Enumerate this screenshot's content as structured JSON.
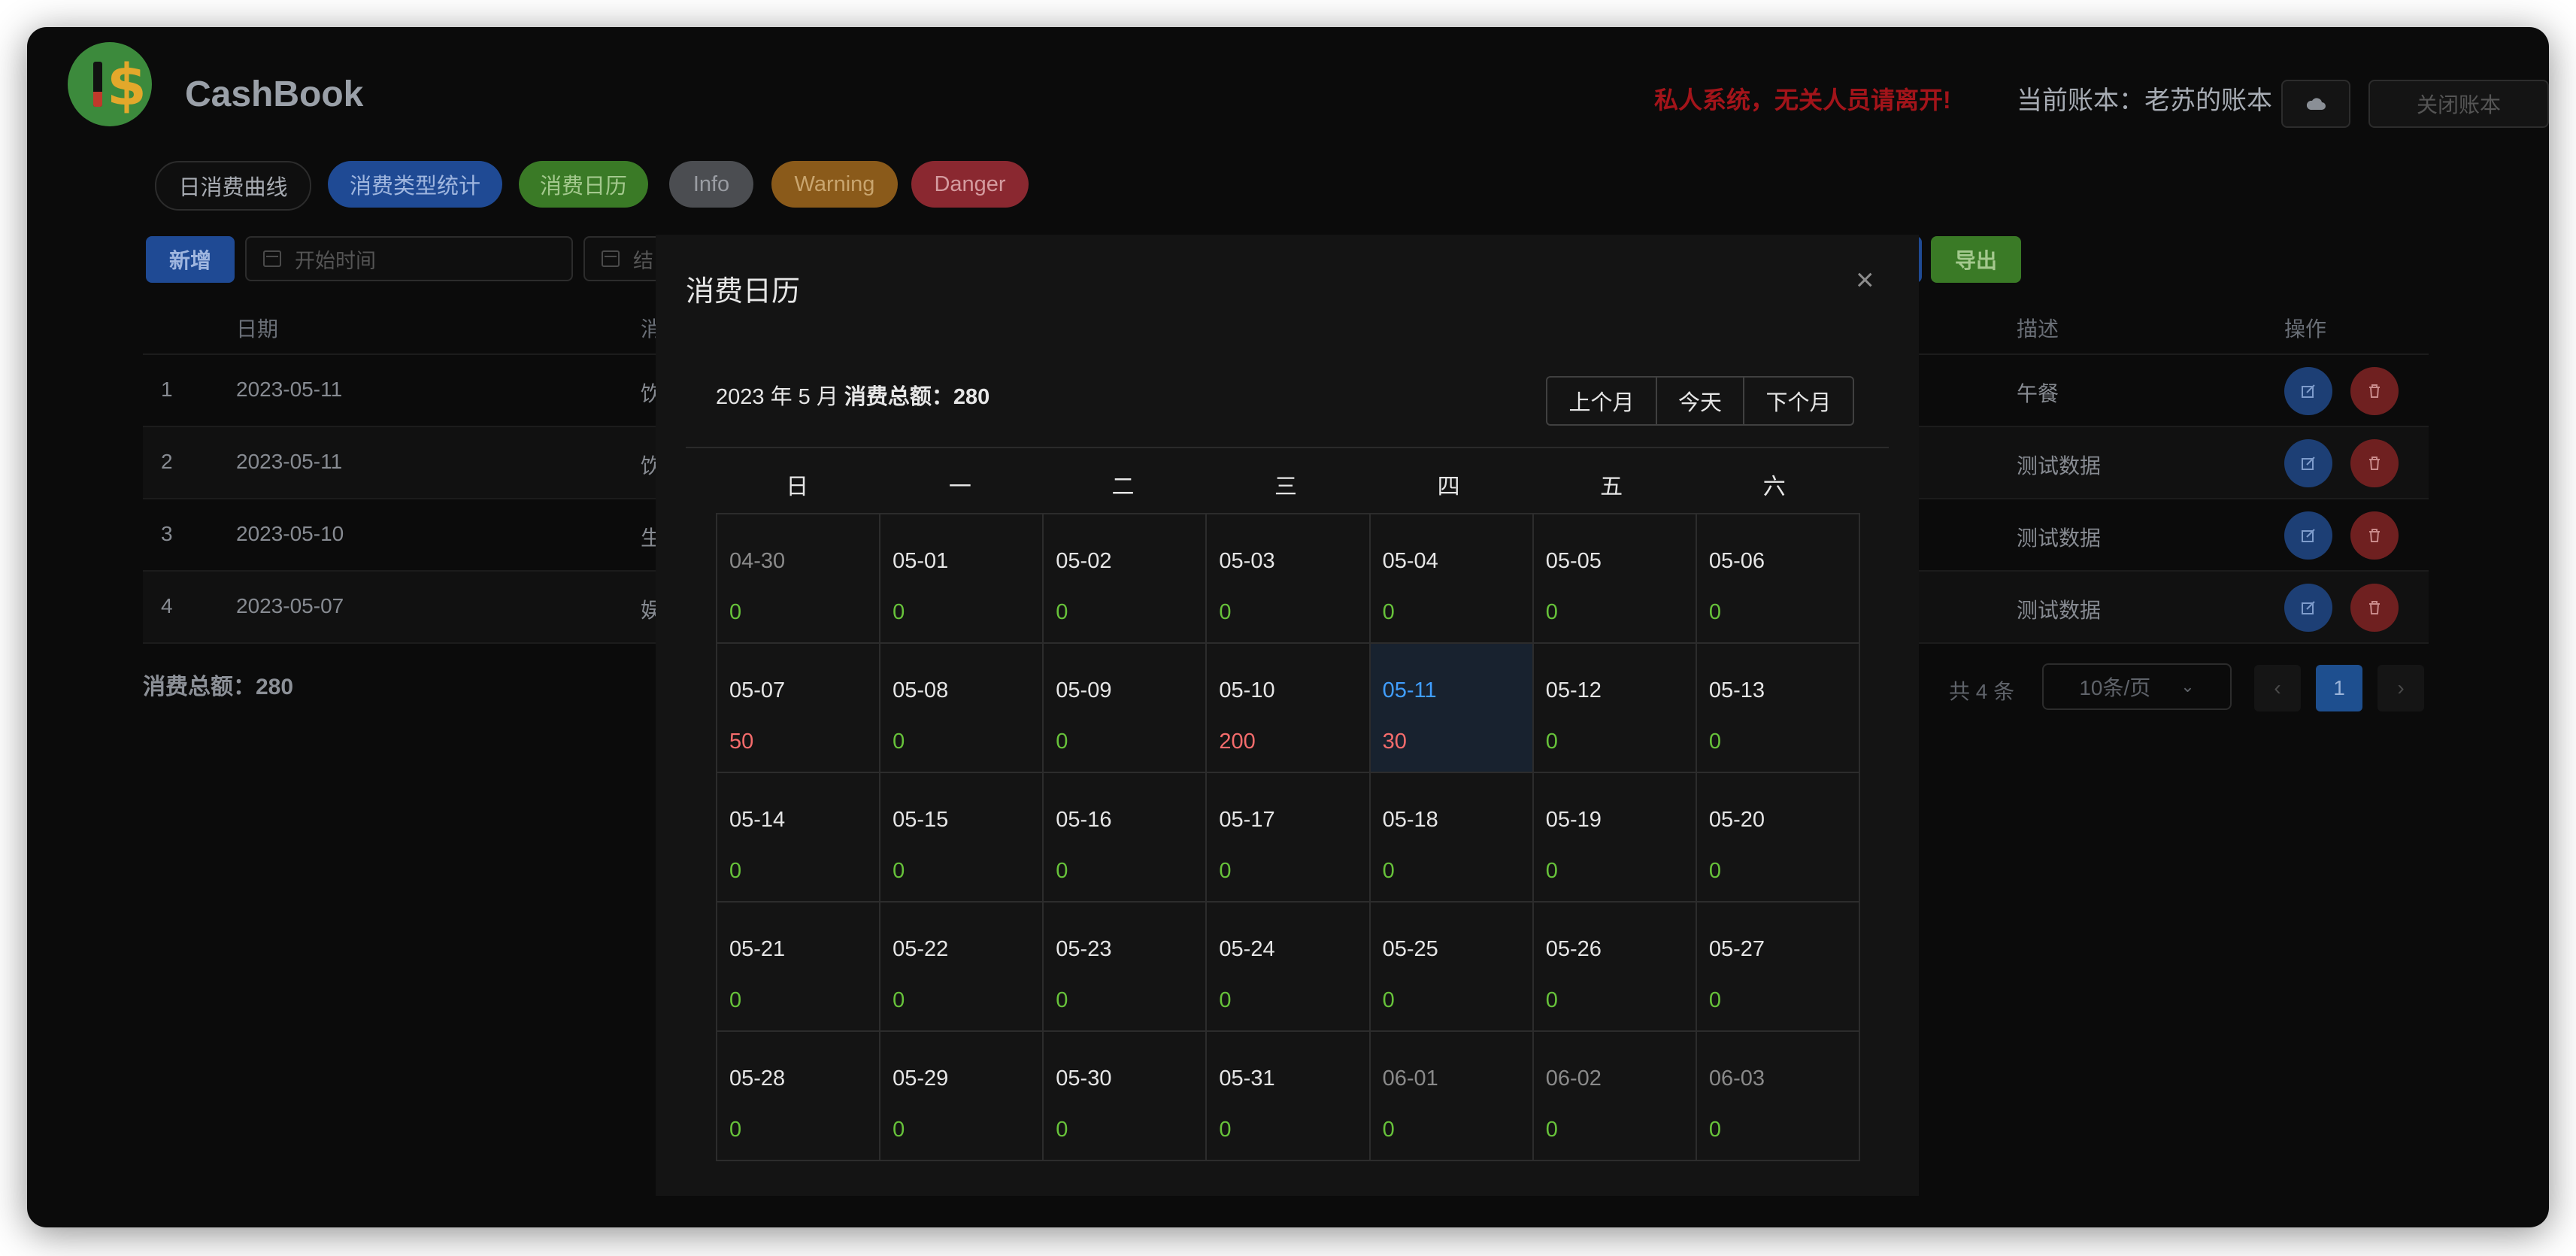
{
  "app": {
    "title": "CashBook",
    "warning": "私人系统，无关人员请离开!",
    "account_label": "当前账本：老苏的账本",
    "cloud_button_icon": "cloud-icon",
    "close_account_label": "关闭账本"
  },
  "nav_pills": [
    {
      "label": "日消费曲线",
      "color": "#0f0f0f",
      "text_color": "#a7abb2"
    },
    {
      "label": "消费类型统计",
      "color": "#1f4a94",
      "text_color": "#9fb6df"
    },
    {
      "label": "消费日历",
      "color": "#3a7a26",
      "text_color": "#a4c98e"
    },
    {
      "label": "Info",
      "color": "#4b4d51",
      "text_color": "#9a9da3"
    },
    {
      "label": "Warning",
      "color": "#8a5a1a",
      "text_color": "#c9a56e"
    },
    {
      "label": "Danger",
      "color": "#8a2830",
      "text_color": "#d49b9f"
    }
  ],
  "toolbar": {
    "add_label": "新增",
    "start_placeholder": "开始时间",
    "end_placeholder": "结",
    "export_label": "导出"
  },
  "table": {
    "headers": {
      "date": "日期",
      "type": "消",
      "desc": "描述",
      "actions": "操作"
    },
    "rows": [
      {
        "index": "1",
        "date": "2023-05-11",
        "type": "饮",
        "desc": "午餐"
      },
      {
        "index": "2",
        "date": "2023-05-11",
        "type": "饮",
        "desc": "测试数据"
      },
      {
        "index": "3",
        "date": "2023-05-10",
        "type": "生",
        "desc": "测试数据"
      },
      {
        "index": "4",
        "date": "2023-05-07",
        "type": "娱",
        "desc": "测试数据"
      }
    ],
    "total_label": "消费总额：280"
  },
  "pagination": {
    "total_text": "共 4 条",
    "page_size": "10条/页",
    "prev": "‹",
    "current_page": "1",
    "next": "›"
  },
  "dialog": {
    "title": "消费日历",
    "close": "×",
    "header_prefix": "2023 年 5 月",
    "header_total": "消费总额：280",
    "nav": {
      "prev_month": "上个月",
      "today": "今天",
      "next_month": "下个月"
    },
    "weekdays": [
      "日",
      "一",
      "二",
      "三",
      "四",
      "五",
      "六"
    ],
    "weeks": [
      [
        {
          "date": "04-30",
          "amount": "0",
          "other": true
        },
        {
          "date": "05-01",
          "amount": "0"
        },
        {
          "date": "05-02",
          "amount": "0"
        },
        {
          "date": "05-03",
          "amount": "0"
        },
        {
          "date": "05-04",
          "amount": "0"
        },
        {
          "date": "05-05",
          "amount": "0"
        },
        {
          "date": "05-06",
          "amount": "0"
        }
      ],
      [
        {
          "date": "05-07",
          "amount": "50"
        },
        {
          "date": "05-08",
          "amount": "0"
        },
        {
          "date": "05-09",
          "amount": "0"
        },
        {
          "date": "05-10",
          "amount": "200"
        },
        {
          "date": "05-11",
          "amount": "30",
          "today": true
        },
        {
          "date": "05-12",
          "amount": "0"
        },
        {
          "date": "05-13",
          "amount": "0"
        }
      ],
      [
        {
          "date": "05-14",
          "amount": "0"
        },
        {
          "date": "05-15",
          "amount": "0"
        },
        {
          "date": "05-16",
          "amount": "0"
        },
        {
          "date": "05-17",
          "amount": "0"
        },
        {
          "date": "05-18",
          "amount": "0"
        },
        {
          "date": "05-19",
          "amount": "0"
        },
        {
          "date": "05-20",
          "amount": "0"
        }
      ],
      [
        {
          "date": "05-21",
          "amount": "0"
        },
        {
          "date": "05-22",
          "amount": "0"
        },
        {
          "date": "05-23",
          "amount": "0"
        },
        {
          "date": "05-24",
          "amount": "0"
        },
        {
          "date": "05-25",
          "amount": "0"
        },
        {
          "date": "05-26",
          "amount": "0"
        },
        {
          "date": "05-27",
          "amount": "0"
        }
      ],
      [
        {
          "date": "05-28",
          "amount": "0"
        },
        {
          "date": "05-29",
          "amount": "0"
        },
        {
          "date": "05-30",
          "amount": "0"
        },
        {
          "date": "05-31",
          "amount": "0"
        },
        {
          "date": "06-01",
          "amount": "0",
          "other": true
        },
        {
          "date": "06-02",
          "amount": "0",
          "other": true
        },
        {
          "date": "06-03",
          "amount": "0",
          "other": true
        }
      ]
    ]
  },
  "colors": {
    "spend": "#f56c6c",
    "zero": "#67c23a",
    "today": "#409eff"
  }
}
